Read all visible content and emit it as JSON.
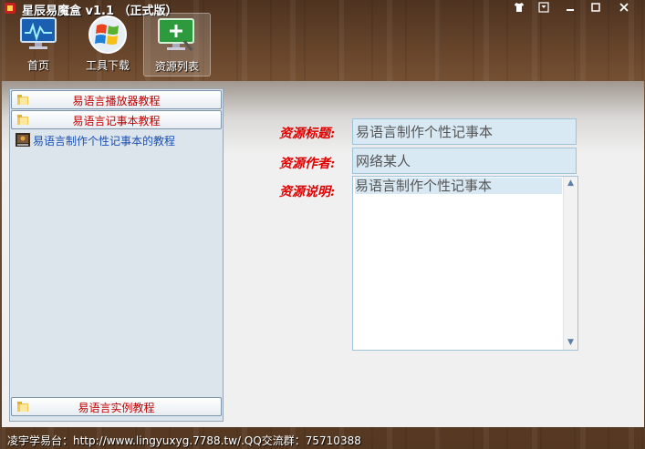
{
  "window": {
    "title": "星辰易魔盒 v1.1 （正式版）",
    "controls": [
      "shirt-icon",
      "minimize-to-tray-icon",
      "minimize-icon",
      "maximize-icon",
      "close-icon"
    ]
  },
  "toolbar": {
    "items": [
      {
        "label": "首页",
        "icon": "monitor-icon"
      },
      {
        "label": "工具下载",
        "icon": "windows-logo-icon"
      },
      {
        "label": "资源列表",
        "icon": "monitor-add-icon",
        "active": true
      }
    ]
  },
  "sidebar": {
    "categories": [
      {
        "label": "易语言播放器教程"
      },
      {
        "label": "易语言记事本教程"
      },
      {
        "label": "易语言实例教程"
      }
    ],
    "resources": [
      {
        "label": "易语言制作个性记事本的教程"
      }
    ]
  },
  "detail": {
    "title_label": "资源标题:",
    "title_value": "易语言制作个性记事本",
    "author_label": "资源作者:",
    "author_value": "网络某人",
    "desc_label": "资源说明:",
    "desc_value": "易语言制作个性记事本"
  },
  "status_bar": {
    "text": "凌宇学易台：http://www.lingyuxyg.7788.tw/.QQ交流群：75710388"
  },
  "colors": {
    "accent_red": "#e00000",
    "link_blue": "#1a4fb3"
  }
}
